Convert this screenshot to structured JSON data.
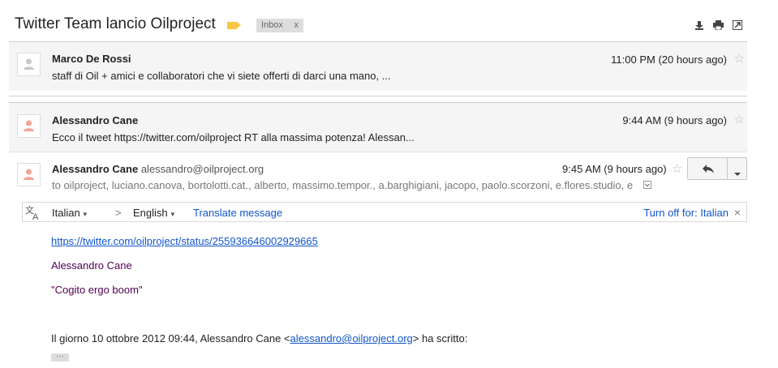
{
  "subject": "Twitter Team lancio Oilproject",
  "label_chip": {
    "text": "Inbox",
    "close": "x"
  },
  "messages": [
    {
      "sender": "Marco De Rossi",
      "time": "11:00 PM (20 hours ago)",
      "snippet": "staff di Oil + amici e collaboratori che vi siete offerti di darci una mano, ..."
    },
    {
      "sender": "Alessandro Cane",
      "time": "9:44 AM (9 hours ago)",
      "snippet": "Ecco il tweet https://twitter.com/oilproject RT alla massima potenza! Alessan..."
    }
  ],
  "open_message": {
    "sender": "Alessandro Cane",
    "email": "alessandro@oilproject.org",
    "time": "9:45 AM (9 hours ago)",
    "to": "to oilproject, luciano.canova, bortolotti.cat., alberto, massimo.tempor., a.barghigiani, jacopo, paolo.scorzoni, e.flores.studio, e"
  },
  "translate": {
    "from": "Italian",
    "arrow": ">",
    "to": "English",
    "action": "Translate message",
    "turn_off": "Turn off for: Italian",
    "close": "×"
  },
  "body": {
    "link": "https://twitter.com/oilproject/status/255936646002929665",
    "name": "Alessandro Cane",
    "quote": "\"Cogito ergo boom\"",
    "quoted_intro": "Il giorno 10 ottobre 2012 09:44, Alessandro Cane <",
    "quoted_email": "alessandro@oilproject.org",
    "quoted_outro": "> ha scritto:",
    "ellipsis": "···"
  },
  "colors": {
    "link": "#1155cc",
    "purple": "#500050",
    "label": "#f6c744",
    "avatar": "#f4a396"
  }
}
